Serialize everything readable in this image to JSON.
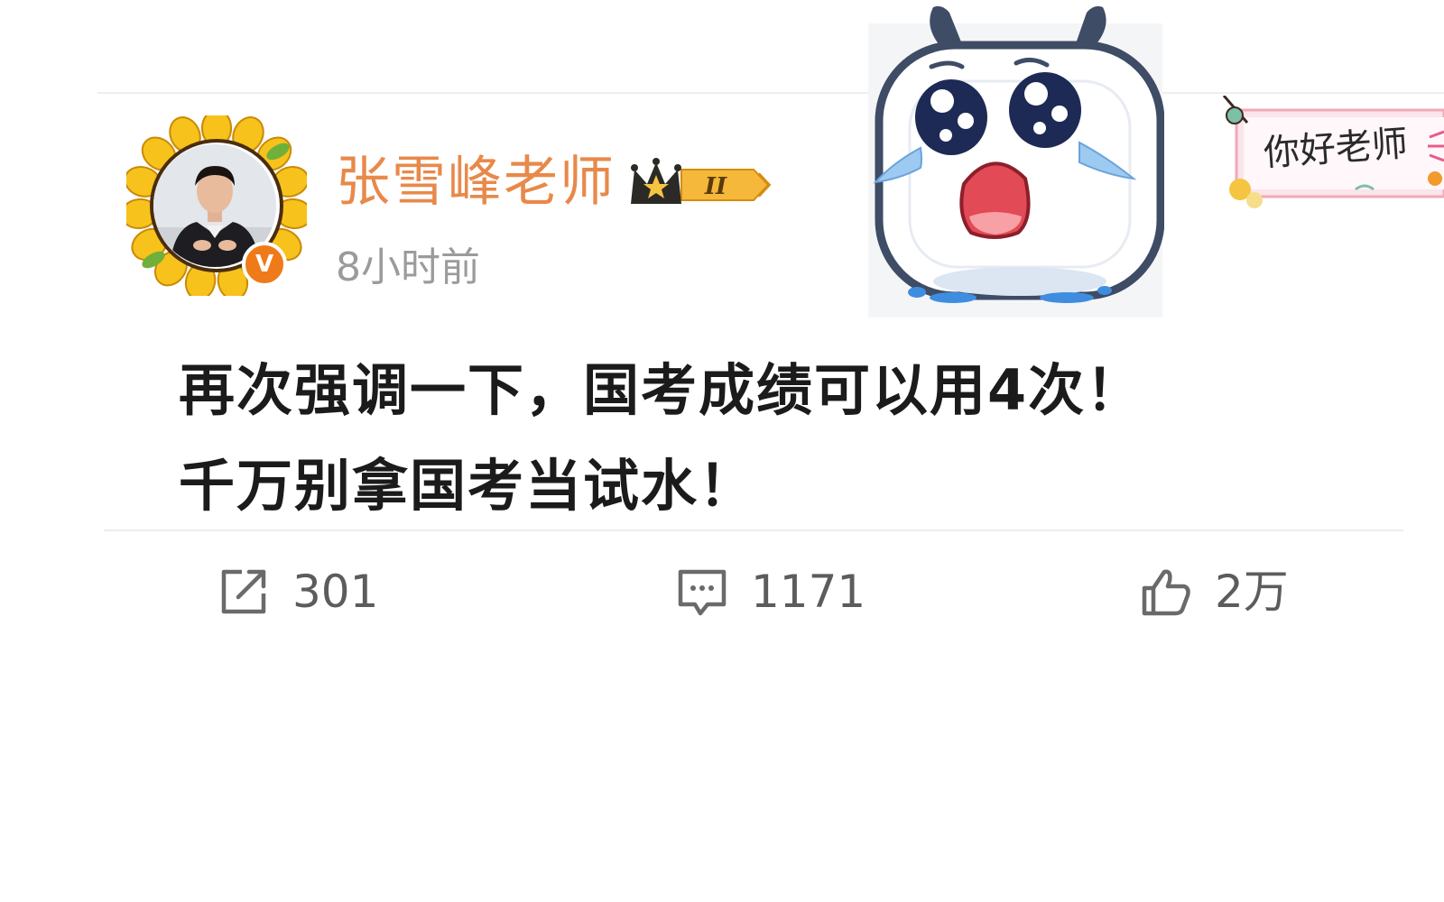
{
  "post": {
    "author": {
      "name": "张雪峰老师",
      "avatar_icon": "avatar-photo",
      "verified_icon": "v-verified-badge",
      "verified_mark": "V",
      "vip_badge_icon": "crown-vip-icon",
      "vip_level": "II"
    },
    "timestamp": "8小时前",
    "card_decoration_text": "你好老师",
    "sticker_icon": "crying-tv-sticker",
    "body_lines": [
      "再次强调一下，国考成绩可以用4次！",
      "千万别拿国考当试水！"
    ],
    "actions": {
      "repost": {
        "icon": "repost-icon",
        "count": "301"
      },
      "comment": {
        "icon": "comment-icon",
        "count": "1171"
      },
      "like": {
        "icon": "thumbs-up-icon",
        "count": "2万"
      }
    }
  },
  "colors": {
    "username": "#e8894a",
    "timestamp": "#9b9b9b",
    "body_text": "#1b1b1b",
    "action_text": "#5c5c5c",
    "verified_badge": "#ef7a19",
    "vip_gold": "#f5b83a"
  }
}
